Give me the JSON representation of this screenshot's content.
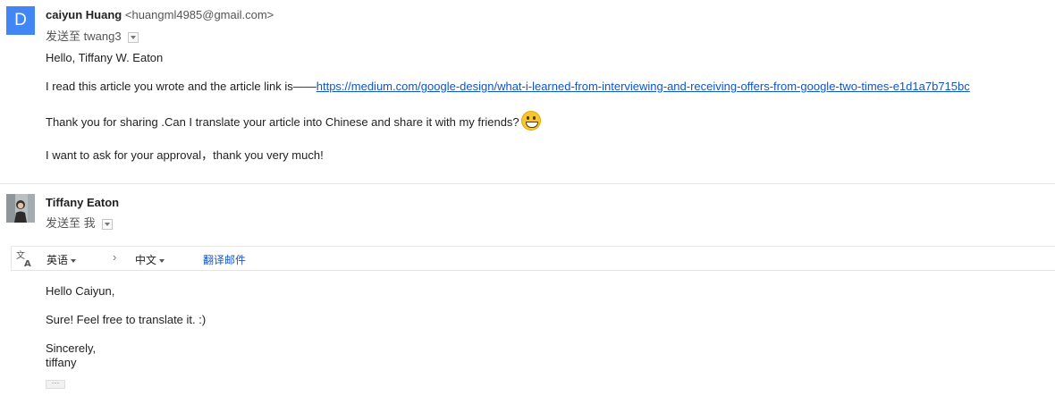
{
  "message1": {
    "avatar_letter": "D",
    "sender_name": "caiyun Huang",
    "sender_email": "<huangml4985@gmail.com>",
    "to_prefix": "发送至",
    "to_recipient": "twang3",
    "body": {
      "greeting": "Hello, Tiffany W. Eaton",
      "para1_text": "I read this article you wrote and the article link is——",
      "para1_link": "https://medium.com/google-design/what-i-learned-from-interviewing-and-receiving-offers-from-google-two-times-e1d1a7b715bc",
      "para2": "Thank you for sharing .Can I translate your article into Chinese and share it with my friends?",
      "para3": "I want to ask for your approval，thank you very much!"
    }
  },
  "message2": {
    "sender_name": "Tiffany Eaton",
    "to_prefix": "发送至",
    "to_recipient": "我",
    "translate_bar": {
      "source_lang": "英语",
      "target_lang": "中文",
      "translate_link": "翻译邮件"
    },
    "body": {
      "greeting": "Hello Caiyun,",
      "para1": "Sure! Feel free to translate it. :)",
      "closing": "Sincerely,",
      "signature": "tiffany"
    },
    "more_label": "···"
  },
  "icons": {
    "avatar_photo": "user-photo-icon",
    "dropdown": "chevron-down-icon",
    "emoji": "grinning-face-icon",
    "translate": "translate-icon",
    "arrow": "chevron-right-icon"
  },
  "colors": {
    "avatar_bg": "#4285f4",
    "link": "#1155cc",
    "emoji": "#f6c531"
  }
}
